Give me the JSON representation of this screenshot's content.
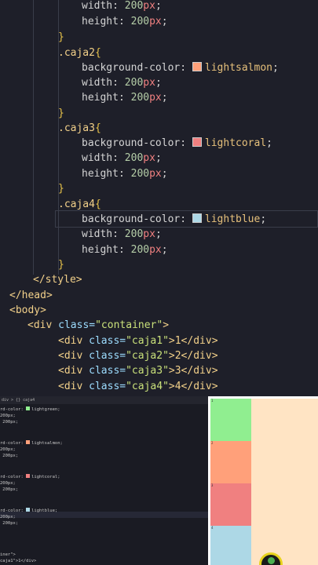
{
  "colors": {
    "editor_bg": "#1e1f29",
    "lightgreen": "#90ee90",
    "lightsalmon": "#ffa07a",
    "lightcoral": "#f08080",
    "lightblue": "#add8e6",
    "container_bg": "#ffe4c4"
  },
  "editor": {
    "lines": {
      "l1_prop": "width: ",
      "l1_num": "200",
      "l1_unit": "px",
      "l2_prop": "height: ",
      "l2_num": "200",
      "l2_unit": "px",
      "l3_brace": "}",
      "l4_sel": ".caja2",
      "l4_brace": "{",
      "l5_prop": "background-color: ",
      "l5_val": "lightsalmon",
      "l6_prop": "width: ",
      "l6_num": "200",
      "l6_unit": "px",
      "l7_prop": "height: ",
      "l7_num": "200",
      "l7_unit": "px",
      "l8_brace": "}",
      "l9_sel": ".caja3",
      "l9_brace": "{",
      "l10_prop": "background-color: ",
      "l10_val": "lightcoral",
      "l11_prop": "width: ",
      "l11_num": "200",
      "l11_unit": "px",
      "l12_prop": "height: ",
      "l12_num": "200",
      "l12_unit": "px",
      "l13_brace": "}",
      "l14_sel": ".caja4",
      "l14_brace": "{",
      "l15_prop": "background-color: ",
      "l15_val": "lightblue",
      "l16_prop": "width: ",
      "l16_num": "200",
      "l16_unit": "px",
      "l17_prop": "height: ",
      "l17_num": "200",
      "l17_unit": "px",
      "l18_brace": "}",
      "l19": "</style>",
      "l20": "</head>",
      "l21": "<body>",
      "l22_open": "<div ",
      "l22_attr": "class=",
      "l22_str": "\"container\"",
      "l22_close": ">",
      "l23_open": "<div ",
      "l23_attr": "class=",
      "l23_str": "\"caja1\"",
      "l23_close": ">1</div>",
      "l24_open": "<div ",
      "l24_attr": "class=",
      "l24_str": "\"caja2\"",
      "l24_close": ">2</div>",
      "l25_open": "<div ",
      "l25_attr": "class=",
      "l25_str": "\"caja3\"",
      "l25_close": ">3</div>",
      "l26_open": "<div ",
      "l26_attr": "class=",
      "l26_str": "\"caja4\"",
      "l26_close": ">4</div>"
    }
  },
  "mini": {
    "breadcrumb": "div > {} caja4",
    "m1": "rd-color: ",
    "m1v": "lightgreen;",
    "m2": "200px;",
    "m3": " 200px;",
    "m4": "rd-color: ",
    "m4v": "lightsalmon;",
    "m5": "200px;",
    "m6": " 200px;",
    "m7": "rd-color: ",
    "m7v": "lightcoral;",
    "m8": "200px;",
    "m9": " 200px;",
    "m10": "rd-color: ",
    "m10v": "lightblue;",
    "m11": "200px;",
    "m12": " 200px;",
    "m13": "iner\">",
    "m14": "caja1\">1</div>"
  },
  "preview": {
    "box1": "1",
    "box2": "2",
    "box3": "3",
    "box4": "4"
  }
}
